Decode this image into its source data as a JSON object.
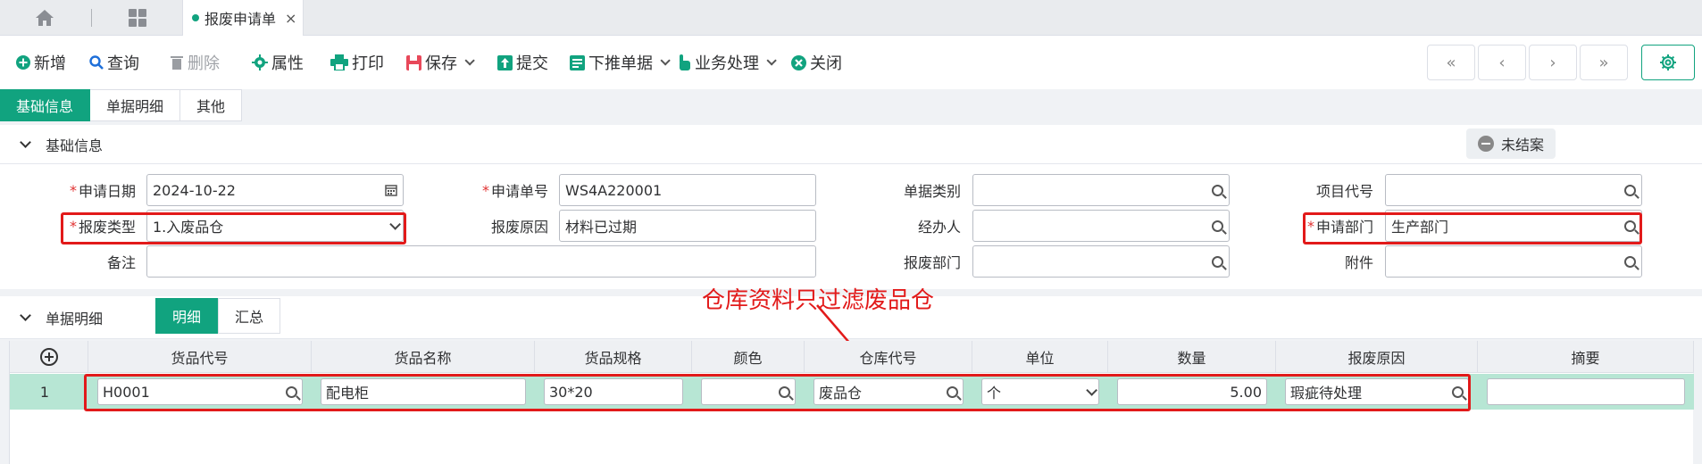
{
  "tabbar": {
    "tab_label": "报废申请单",
    "tab_close": "×"
  },
  "toolbar": {
    "add": "新增",
    "query": "查询",
    "delete": "删除",
    "props": "属性",
    "print": "打印",
    "save": "保存",
    "submit": "提交",
    "push": "下推单据",
    "business": "业务处理",
    "close": "关闭",
    "nav": [
      "«",
      "‹",
      "›",
      "»"
    ]
  },
  "subtabs": [
    "基础信息",
    "单据明细",
    "其他"
  ],
  "sections": {
    "basic": "基础信息",
    "detail": "单据明细"
  },
  "status_badge": "未结案",
  "form": {
    "apply_date_label": "申请日期",
    "apply_date": "2024-10-22",
    "apply_no_label": "申请单号",
    "apply_no": "WS4A220001",
    "doc_type_label": "单据类别",
    "doc_type": "",
    "project_label": "项目代号",
    "project": "",
    "scrap_type_label": "报废类型",
    "scrap_type": "1.入废品仓",
    "scrap_reason_label": "报废原因",
    "scrap_reason": "材料已过期",
    "handler_label": "经办人",
    "handler": "",
    "apply_dept_label": "申请部门",
    "apply_dept": "生产部门",
    "remark_label": "备注",
    "remark": "",
    "scrap_dept_label": "报废部门",
    "scrap_dept": "",
    "attach_label": "附件",
    "attach": ""
  },
  "detail_tabs": [
    "明细",
    "汇总"
  ],
  "annotation": "仓库资料只过滤废品仓",
  "table": {
    "columns": [
      "货品代号",
      "货品名称",
      "货品规格",
      "颜色",
      "仓库代号",
      "单位",
      "数量",
      "报废原因",
      "摘要"
    ],
    "rows": [
      {
        "idx": "1",
        "code": "H0001",
        "name": "配电柜",
        "spec": "30*20",
        "color": "",
        "warehouse": "废品仓",
        "unit": "个",
        "qty": "5.00",
        "reason": "瑕疵待处理",
        "summary": ""
      }
    ]
  },
  "colors": {
    "accent": "#11a37f",
    "highlight": "#e21a1a",
    "row_selected": "#b7e6d4"
  }
}
